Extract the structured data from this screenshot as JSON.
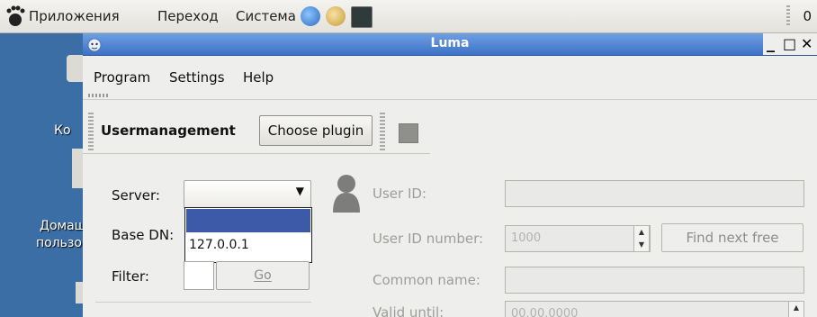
{
  "panel": {
    "menus": [
      "Приложения",
      "Переход",
      "Система"
    ],
    "clock": "0"
  },
  "desktop": {
    "icon_labels": [
      "Ко",
      "Домаш",
      "пользо"
    ]
  },
  "window": {
    "title": "Luma",
    "controls": {
      "minimize": "_",
      "maximize": "□",
      "close": "✕"
    }
  },
  "menubar": {
    "items": [
      "Program",
      "Settings",
      "Help"
    ]
  },
  "toolbar": {
    "title": "Usermanagement",
    "choose_plugin_label": "Choose plugin"
  },
  "left_form": {
    "server_label": "Server:",
    "base_dn_label": "Base DN:",
    "filter_label": "Filter:",
    "server_value": "",
    "server_options": [
      "",
      "127.0.0.1"
    ],
    "go_label": "Go"
  },
  "right_form": {
    "user_id_label": "User ID:",
    "user_id_number_label": "User ID number:",
    "user_id_number_value": "1000",
    "find_next_free_label": "Find next free",
    "common_name_label": "Common name:",
    "valid_until_label": "Valid until:",
    "valid_until_value": "00.00.0000"
  },
  "colors": {
    "desktop": "#3b6ea5",
    "titlebar": "#4a7fd0",
    "dropdown_selected": "#3d5aa8"
  }
}
